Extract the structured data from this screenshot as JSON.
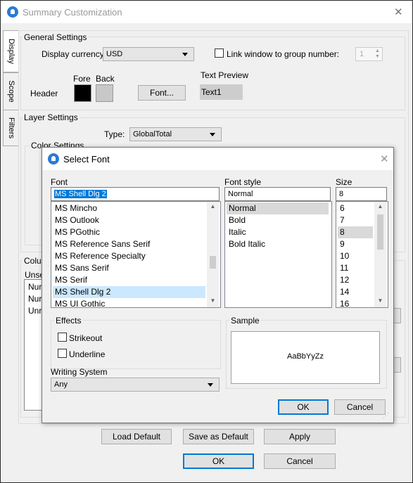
{
  "window": {
    "title": "Summary Customization",
    "close": "✕"
  },
  "side_tabs": [
    "Display",
    "Scope",
    "Filters"
  ],
  "general": {
    "group_label": "General Settings",
    "currency_label": "Display currency:",
    "currency_value": "USD",
    "link_label": "Link window to group number:",
    "link_value": "1",
    "fore_label": "Fore",
    "back_label": "Back",
    "header_label": "Header",
    "font_button": "Font...",
    "preview_label": "Text Preview",
    "preview_text": "Text1",
    "colors": {
      "fore": "#000000",
      "back": "#c8c8c8",
      "preview_bg": "#cdcdcd"
    }
  },
  "layer": {
    "group_label": "Layer Settings",
    "type_label": "Type:",
    "type_value": "GlobalTotal",
    "color_settings_label": "Color Settings"
  },
  "columns": {
    "group_label": "Colun",
    "unsel_label": "Unsel",
    "items": [
      "Nur",
      "Nur",
      "Unre"
    ]
  },
  "bottom_buttons": {
    "load_default": "Load Default",
    "save_default": "Save as Default",
    "apply": "Apply",
    "ok": "OK",
    "cancel": "Cancel"
  },
  "font_dialog": {
    "title": "Select Font",
    "close": "✕",
    "font_label": "Font",
    "font_value": "MS Shell Dlg 2",
    "fonts": [
      "MS Mincho",
      "MS Outlook",
      "MS PGothic",
      "MS Reference Sans Serif",
      "MS Reference Specialty",
      "MS Sans Serif",
      "MS Serif",
      "MS Shell Dlg 2",
      "MS UI Gothic"
    ],
    "selected_font": "MS Shell Dlg 2",
    "style_label": "Font style",
    "style_value": "Normal",
    "styles": [
      "Normal",
      "Bold",
      "Italic",
      "Bold Italic"
    ],
    "size_label": "Size",
    "size_value": "8",
    "sizes": [
      "6",
      "7",
      "8",
      "9",
      "10",
      "11",
      "12",
      "14",
      "16"
    ],
    "effects_label": "Effects",
    "strikeout_label": "Strikeout",
    "underline_label": "Underline",
    "sample_label": "Sample",
    "sample_text": "AaBbYyZz",
    "writing_system_label": "Writing System",
    "writing_system_value": "Any",
    "ok": "OK",
    "cancel": "Cancel",
    "colors": {
      "selection": "#cce8ff",
      "style_selection": "#d9d9d9",
      "accent": "#0078d7"
    }
  }
}
